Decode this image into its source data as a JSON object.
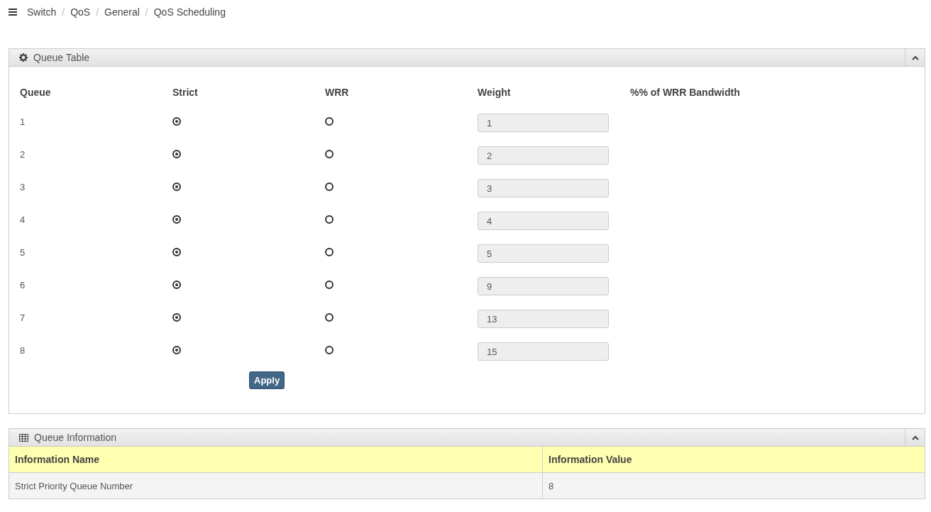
{
  "breadcrumb": [
    "Switch",
    "QoS",
    "General",
    "QoS Scheduling"
  ],
  "breadcrumb_separator": "/",
  "queue_table": {
    "title": "Queue Table",
    "expanded": true,
    "columns": [
      "Queue",
      "Strict",
      "WRR",
      "Weight",
      "%% of WRR Bandwidth"
    ],
    "rows": [
      {
        "queue": "1",
        "strict_selected": true,
        "wrr_selected": false,
        "weight": "1",
        "disabled": true
      },
      {
        "queue": "2",
        "strict_selected": true,
        "wrr_selected": false,
        "weight": "2",
        "disabled": true
      },
      {
        "queue": "3",
        "strict_selected": true,
        "wrr_selected": false,
        "weight": "3",
        "disabled": true
      },
      {
        "queue": "4",
        "strict_selected": true,
        "wrr_selected": false,
        "weight": "4",
        "disabled": true
      },
      {
        "queue": "5",
        "strict_selected": true,
        "wrr_selected": false,
        "weight": "5",
        "disabled": true
      },
      {
        "queue": "6",
        "strict_selected": true,
        "wrr_selected": false,
        "weight": "9",
        "disabled": true
      },
      {
        "queue": "7",
        "strict_selected": true,
        "wrr_selected": false,
        "weight": "13",
        "disabled": true
      },
      {
        "queue": "8",
        "strict_selected": true,
        "wrr_selected": false,
        "weight": "15",
        "disabled": true
      }
    ],
    "apply_button": "Apply"
  },
  "queue_information": {
    "title": "Queue Information",
    "expanded": true,
    "columns": [
      "Information Name",
      "Information Value"
    ],
    "rows": [
      [
        "Strict Priority Queue Number",
        "8"
      ]
    ]
  }
}
